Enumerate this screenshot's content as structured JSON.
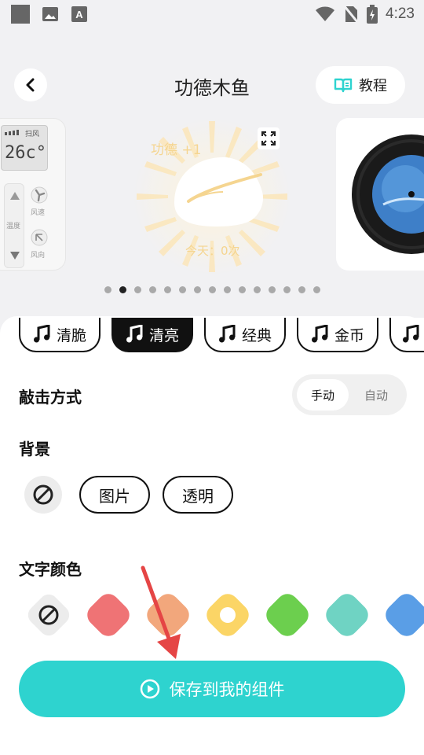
{
  "status_bar": {
    "time": "4:23"
  },
  "header": {
    "title": "功德木鱼",
    "tutorial_label": "教程"
  },
  "carousel": {
    "left_card": {
      "mode": "扫风",
      "temp": "26c°",
      "labels": [
        "温度",
        "风速",
        "风向"
      ]
    },
    "center_card": {
      "merit": "功德 +1",
      "today": "今天：0次"
    },
    "dot_count": 15,
    "active_dot": 1
  },
  "sounds": [
    {
      "label": "清脆"
    },
    {
      "label": "清亮"
    },
    {
      "label": "经典"
    },
    {
      "label": "金币"
    },
    {
      "label": ""
    }
  ],
  "active_sound": "清亮",
  "strike": {
    "label": "敲击方式",
    "manual": "手动",
    "auto": "自动",
    "selected": "手动"
  },
  "background": {
    "label": "背景",
    "options": [
      "图片",
      "透明"
    ]
  },
  "text_color": {
    "label": "文字颜色",
    "swatches": [
      "#ef7375",
      "#f2a77c",
      "#fbd566",
      "#6ccf4e",
      "#6fd3c3",
      "#5a9ee6"
    ],
    "selected_index": 2
  },
  "save_label": "保存到我的组件",
  "colors": {
    "accent": "#2ed3cf",
    "arrow": "#e54545"
  }
}
